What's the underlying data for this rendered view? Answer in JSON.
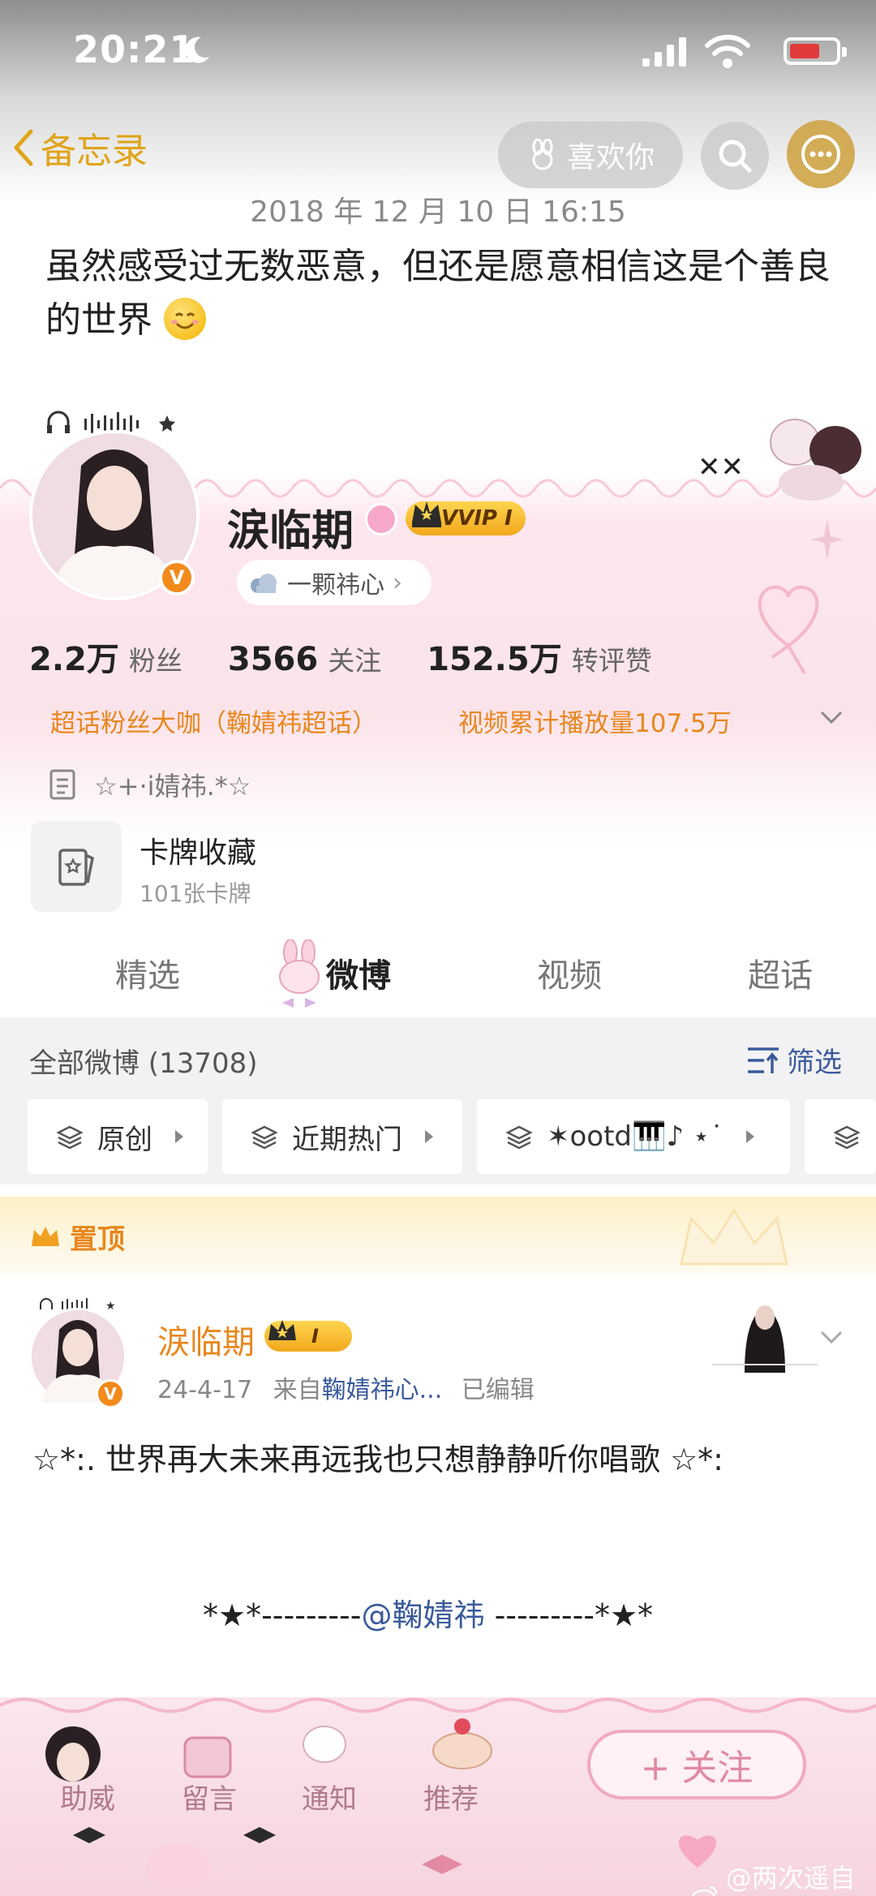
{
  "status_bar": {
    "time": "20:21"
  },
  "nav": {
    "back_label": "备忘录",
    "like_label": "喜欢你"
  },
  "memo": {
    "date": "2018 年 12 月 10 日 16:15",
    "text": "虽然感受过无数恶意，但还是愿意相信这是个善良的世界"
  },
  "profile": {
    "username": "涙临期",
    "vip_label": "VVIP I",
    "verified_mark": "V",
    "tag": "一颗祎心",
    "stats": [
      {
        "value": "2.2万",
        "label": "粉丝"
      },
      {
        "value": "3566",
        "label": "关注"
      },
      {
        "value": "152.5万",
        "label": "转评赞"
      }
    ],
    "super_topic": "超话粉丝大咖（鞠婧祎超话）",
    "video_plays": "视频累计播放量107.5万",
    "bio": "☆+·i婧祎.*☆",
    "cards": {
      "title": "卡牌收藏",
      "subtitle": "101张卡牌"
    }
  },
  "tabs": [
    {
      "label": "精选"
    },
    {
      "label": "微博"
    },
    {
      "label": "视频"
    },
    {
      "label": "超话"
    }
  ],
  "feed": {
    "all_label": "全部微博 (13708)",
    "filter_label": "筛选",
    "chips": [
      {
        "label": "原创"
      },
      {
        "label": "近期热门"
      },
      {
        "label": "✶ootd🎹♪ ⋆˙"
      }
    ],
    "pinned_label": "置顶"
  },
  "post": {
    "author": "涙临期",
    "vip_label": "I",
    "date": "24-4-17",
    "from_prefix": "来自",
    "source": "鞠婧祎心...",
    "edited": "已编辑",
    "text": "☆*:. 世界再大未来再远我也只想静静听你唱歌 ☆*:",
    "mention_prefix": "*★*---------",
    "mention": "@鞠婧祎",
    "mention_suffix": " ---------*★*"
  },
  "bottom_bar": {
    "items": [
      "助威",
      "留言",
      "通知",
      "推荐"
    ],
    "follow_label": "+ 关注"
  },
  "watermark": "@两次遥自恰",
  "colors": {
    "accent_orange": "#e8871e",
    "link_blue": "#3a5a9a",
    "gold": "#e0a419",
    "pink": "#f1a9bf"
  }
}
